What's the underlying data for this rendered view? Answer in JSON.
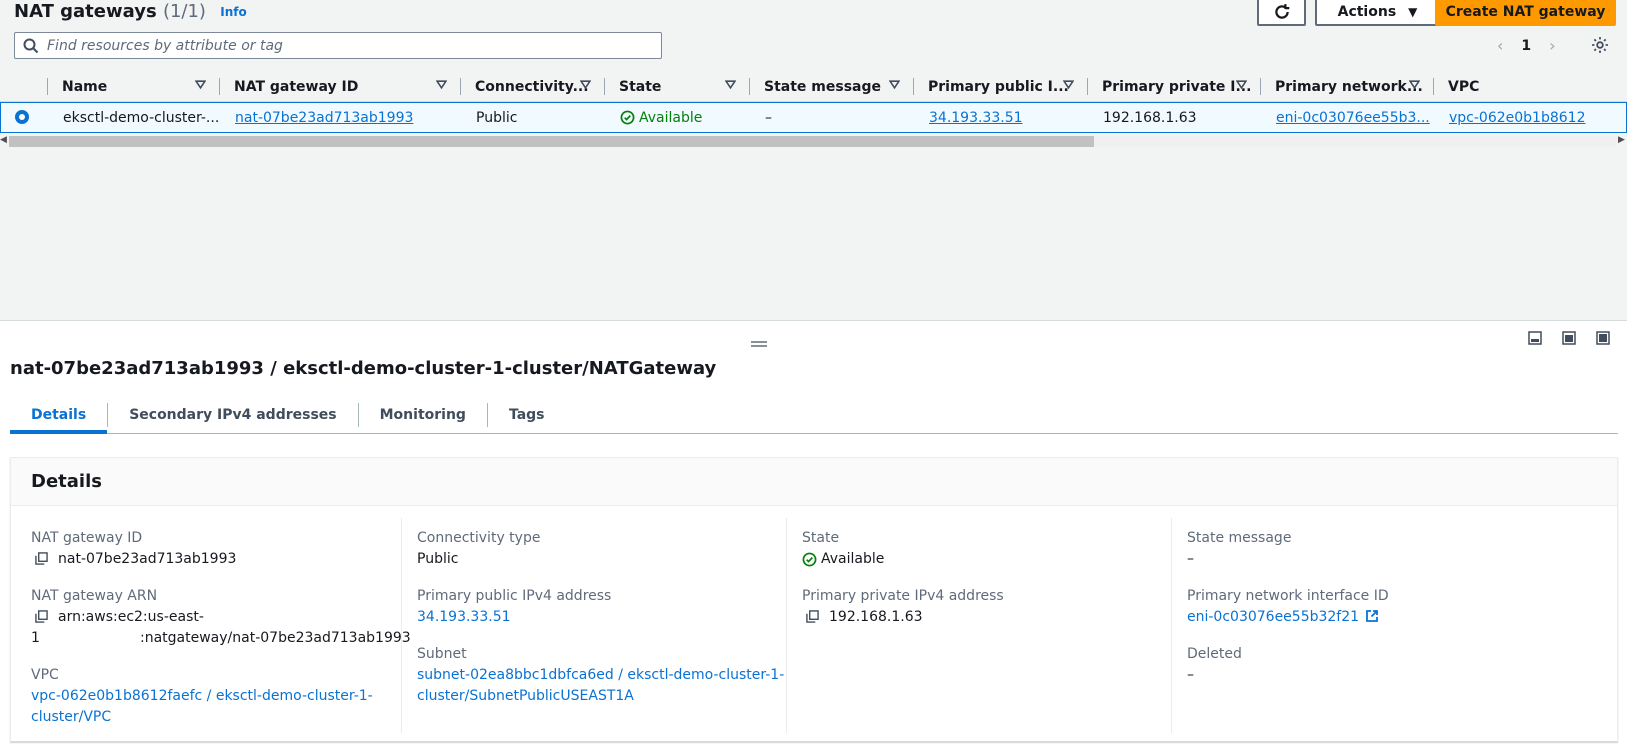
{
  "header": {
    "title": "NAT gateways",
    "count": "(1/1)",
    "info": "Info",
    "actions_label": "Actions",
    "create_label": "Create NAT gateway"
  },
  "search": {
    "placeholder": "Find resources by attribute or tag"
  },
  "pagination": {
    "page": "1"
  },
  "table": {
    "columns": [
      "Name",
      "NAT gateway ID",
      "Connectivity...",
      "State",
      "State message",
      "Primary public I...",
      "Primary private I...",
      "Primary network...",
      "VPC"
    ],
    "row": {
      "name": "eksctl-demo-cluster-...",
      "nat_id": "nat-07be23ad713ab1993",
      "connectivity": "Public",
      "state": "Available",
      "state_message": "–",
      "public_ip": "34.193.33.51",
      "private_ip": "192.168.1.63",
      "network_interface": "eni-0c03076ee55b3...",
      "vpc": "vpc-062e0b1b8612"
    }
  },
  "detail": {
    "title": "nat-07be23ad713ab1993 / eksctl-demo-cluster-1-cluster/NATGateway",
    "tabs": [
      "Details",
      "Secondary IPv4 addresses",
      "Monitoring",
      "Tags"
    ],
    "section_title": "Details",
    "fields": {
      "nat_id_label": "NAT gateway ID",
      "nat_id_value": "nat-07be23ad713ab1993",
      "arn_label": "NAT gateway ARN",
      "arn_line1": "arn:aws:ec2:us-east-",
      "arn_line2_a": "1",
      "arn_line2_b": ":natgateway/nat-07be23ad713ab1993",
      "vpc_label": "VPC",
      "vpc_line1": "vpc-062e0b1b8612faefc / eksctl-demo-cluster-1-",
      "vpc_line2": "cluster/VPC",
      "connectivity_label": "Connectivity type",
      "connectivity_value": "Public",
      "public_ip_label": "Primary public IPv4 address",
      "public_ip_value": "34.193.33.51",
      "subnet_label": "Subnet",
      "subnet_line1": "subnet-02ea8bbc1dbfca6ed / eksctl-demo-cluster-1-",
      "subnet_line2": "cluster/SubnetPublicUSEAST1A",
      "state_label": "State",
      "state_value": "Available",
      "private_ip_label": "Primary private IPv4 address",
      "private_ip_value": "192.168.1.63",
      "state_message_label": "State message",
      "state_message_value": "–",
      "eni_label": "Primary network interface ID",
      "eni_value": "eni-0c03076ee55b32f21",
      "deleted_label": "Deleted",
      "deleted_value": "–"
    }
  },
  "colors": {
    "link": "#0972d3",
    "primary_button": "#ff9900",
    "success": "#037f0c"
  }
}
